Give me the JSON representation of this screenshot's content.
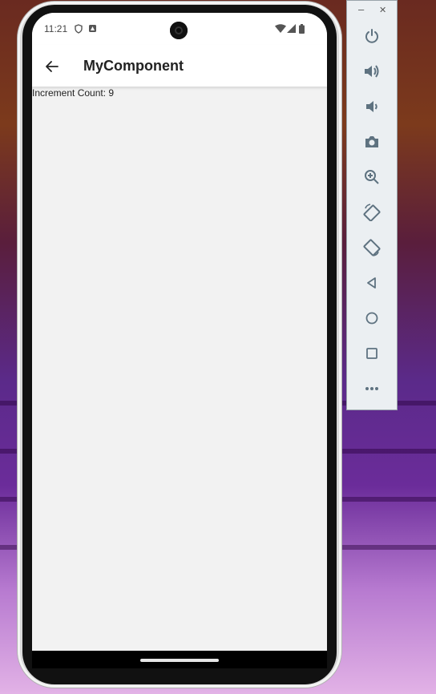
{
  "status_bar": {
    "time": "11:21"
  },
  "appbar": {
    "title": "MyComponent"
  },
  "content": {
    "counter_text": "Increment Count: 9"
  },
  "emulator_panel": {
    "window_buttons": {
      "minimize": "–",
      "close": "✕"
    },
    "tools": [
      "power-icon",
      "volume-up-icon",
      "volume-down-icon",
      "camera-icon",
      "zoom-in-icon",
      "rotate-left-icon",
      "rotate-right-icon",
      "back-icon",
      "home-icon",
      "overview-icon",
      "more-icon"
    ]
  }
}
